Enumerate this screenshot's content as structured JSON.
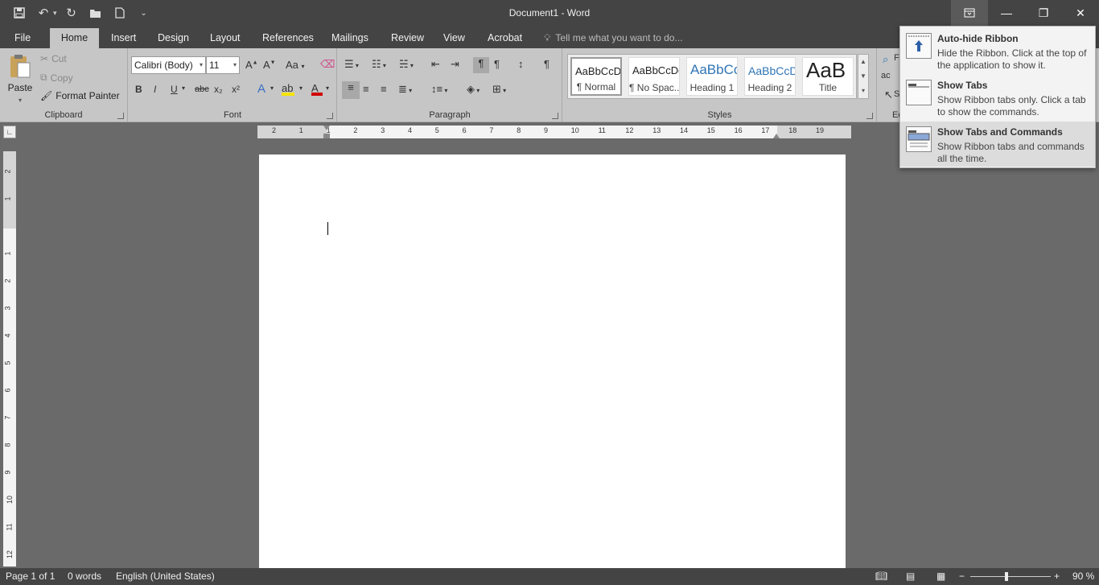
{
  "titlebar": {
    "title": "Document1 - Word"
  },
  "tabs": [
    {
      "label": "File"
    },
    {
      "label": "Home"
    },
    {
      "label": "Insert"
    },
    {
      "label": "Design"
    },
    {
      "label": "Layout"
    },
    {
      "label": "References"
    },
    {
      "label": "Mailings"
    },
    {
      "label": "Review"
    },
    {
      "label": "View"
    },
    {
      "label": "Acrobat"
    }
  ],
  "tellme": {
    "placeholder": "Tell me what you want to do..."
  },
  "clipboard": {
    "label": "Clipboard",
    "paste": "Paste",
    "cut": "Cut",
    "copy": "Copy",
    "format_painter": "Format Painter"
  },
  "font": {
    "label": "Font",
    "family": "Calibri (Body)",
    "size": "11",
    "case": "Aa",
    "bold": "B",
    "italic": "I",
    "underline": "U",
    "strikethrough": "abc",
    "subscript": "x₂",
    "superscript": "x²"
  },
  "paragraph": {
    "label": "Paragraph"
  },
  "styles": {
    "label": "Styles",
    "items": [
      {
        "sample": "AaBbCcDc",
        "name": "¶ Normal"
      },
      {
        "sample": "AaBbCcDc",
        "name": "¶ No Spac..."
      },
      {
        "sample": "AaBbCc",
        "name": "Heading 1"
      },
      {
        "sample": "AaBbCcD",
        "name": "Heading 2"
      },
      {
        "sample": "AaB",
        "name": "Title"
      }
    ]
  },
  "editing": {
    "label": "Ed",
    "find": "F",
    "replace": "ac",
    "select": "S"
  },
  "ruler": {
    "h_numbers": [
      "2",
      "1",
      "1",
      "2",
      "3",
      "4",
      "5",
      "6",
      "7",
      "8",
      "9",
      "10",
      "11",
      "12",
      "13",
      "14",
      "15",
      "16",
      "17",
      "18",
      "19"
    ],
    "v_numbers": [
      "2",
      "1",
      "1",
      "2",
      "3",
      "4",
      "5",
      "6",
      "7",
      "8",
      "9",
      "10",
      "11",
      "12"
    ]
  },
  "status": {
    "page": "Page 1 of 1",
    "words": "0 words",
    "language": "English (United States)",
    "zoom": "90 %"
  },
  "ribbon_options": [
    {
      "title": "Auto-hide Ribbon",
      "desc": "Hide the Ribbon. Click at the top of the application to show it."
    },
    {
      "title": "Show Tabs",
      "desc": "Show Ribbon tabs only. Click a tab to show the commands."
    },
    {
      "title": "Show Tabs and Commands",
      "desc": "Show Ribbon tabs and commands all the time."
    }
  ],
  "colors": {
    "title_bar": "#444444",
    "ribbon": "#c6c6c6",
    "workspace": "#6a6a6a",
    "highlight_yellow": "#f5e400",
    "font_red": "#d00000",
    "heading_blue": "#2e74b5"
  }
}
